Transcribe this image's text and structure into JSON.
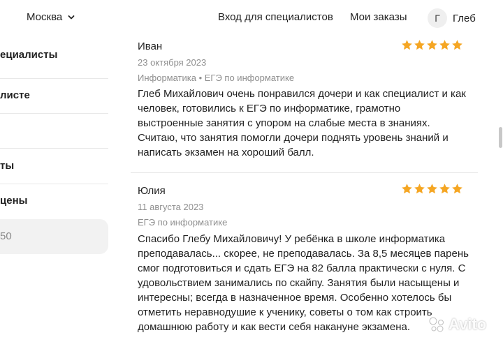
{
  "header": {
    "city": "Москва",
    "nav_specialists": "Вход для специалистов",
    "nav_orders": "Мои заказы",
    "avatar_letter": "Г",
    "user_name": "Глеб"
  },
  "sidebar": {
    "items": [
      {
        "label": "ециалисты"
      },
      {
        "label": "листе"
      },
      {
        "label": "ты"
      },
      {
        "label": "цены"
      }
    ],
    "input_value": "50"
  },
  "reviews": [
    {
      "name": "Иван",
      "date": "23 октября 2023",
      "tags": "Информатика • ЕГЭ по информатике",
      "rating": 5,
      "lines": [
        "Глеб Михайлович очень понравился дочери и как специалист и как",
        "человек, готовились к ЕГЭ по информатике, грамотно",
        "выстроенные занятия с упором на слабые места в знаниях.",
        "Считаю, что занятия помогли дочери поднять уровень знаний и",
        "написать экзамен на хороший балл."
      ]
    },
    {
      "name": "Юлия",
      "date": "11 августа 2023",
      "tags": "ЕГЭ по информатике",
      "rating": 5,
      "lines": [
        "Спасибо Глебу Михайловичу! У ребёнка в школе информатика",
        "преподавалась... скорее, не преподавалась. За 8,5 месяцев парень",
        "смог подготовиться и сдать ЕГЭ на 82 балла практически с нуля. С",
        "удовольствием занимались по скайпу. Занятия были насыщены и",
        "интересны; всегда в назначенное время. Особенно хотелось бы",
        "отметить неравнодушие к ученику, советы о том как строить",
        "домашнюю работу и как вести себя накануне экзамена."
      ]
    }
  ],
  "colors": {
    "star": "#f5a623",
    "muted_text": "#8f8f8f"
  },
  "watermark": "Avito"
}
